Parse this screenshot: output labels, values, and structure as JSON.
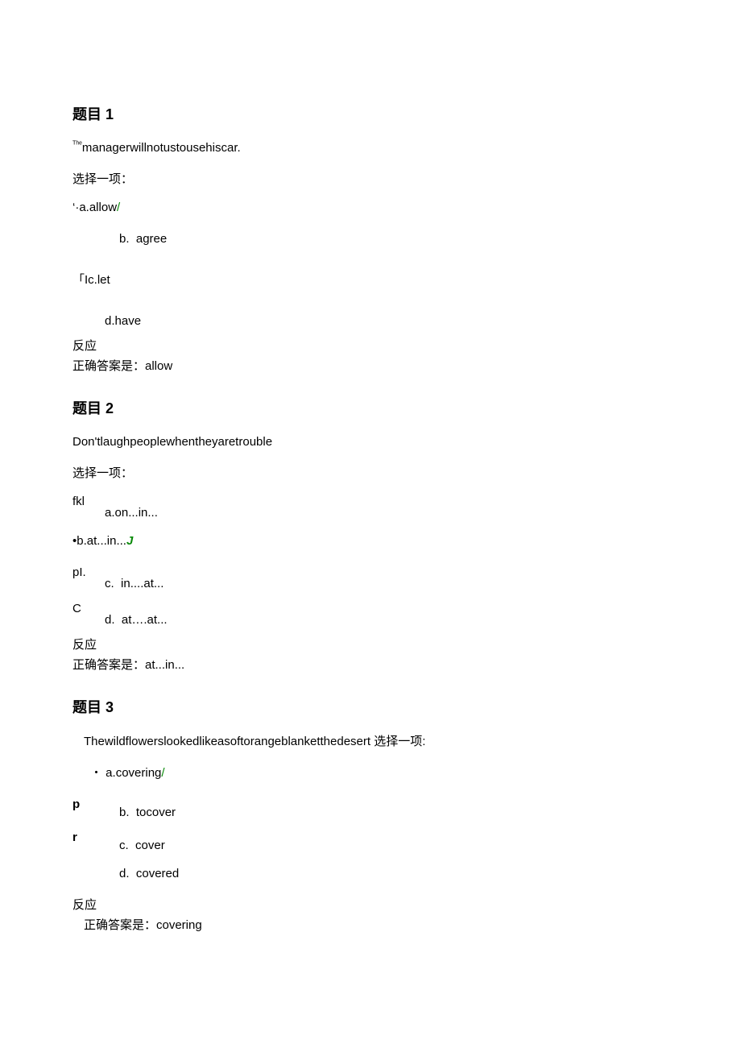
{
  "q1": {
    "title": "题目 1",
    "text_prefix_sup": "ᵀʰᵉ",
    "text": "managerwillnotustousehiscar.",
    "select": "选择一项：",
    "opt_a_prefix": "‘·a.",
    "opt_a": "allow",
    "opt_a_suffix": "/",
    "opt_b_marker": "b.",
    "opt_b": "agree",
    "opt_c_prefix": "「I",
    "opt_c_marker": "c.",
    "opt_c": "let",
    "opt_d_marker": "d.",
    "opt_d": "have",
    "feedback_title": "反应",
    "feedback_text": "正确答案是：allow"
  },
  "q2": {
    "title": "题目 2",
    "text": "Don'tlaughpeoplewhentheyaretrouble",
    "select": "选择一项：",
    "side_a": "fkl",
    "opt_a_marker": "a.",
    "opt_a": "on...in...",
    "opt_b_prefix": "•b.",
    "opt_b": "at...in...",
    "opt_b_suffix": "J",
    "side_c": "pI.",
    "opt_c_marker": "c.",
    "opt_c": "in....at...",
    "side_d": "C",
    "opt_d_marker": "d.",
    "opt_d": "at….at...",
    "feedback_title": "反应",
    "feedback_text": "正确答案是：at...in..."
  },
  "q3": {
    "title": "题目 3",
    "text": "Thewildflowerslookedlikeasoftorangeblanketthedesert 选择一项:",
    "opt_a_prefix": "・ a.",
    "opt_a": "covering",
    "opt_a_suffix": "/",
    "side_b": "p",
    "opt_b_marker": "b.",
    "opt_b": "tocover",
    "side_c": "r",
    "opt_c_marker": "c.",
    "opt_c": "cover",
    "opt_d_marker": "d.",
    "opt_d": "covered",
    "feedback_title": "反应",
    "feedback_text": "正确答案是：covering"
  }
}
